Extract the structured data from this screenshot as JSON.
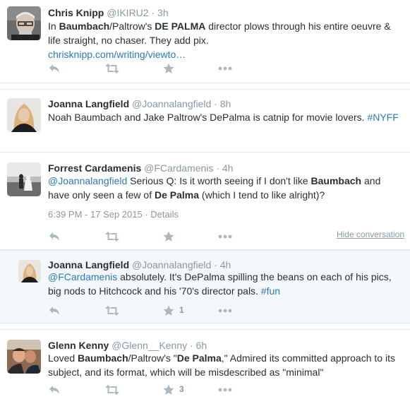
{
  "tweets": [
    {
      "fullname": "Chris Knipp",
      "username": "@IKIRU2",
      "dot": "·",
      "time": "3h",
      "text_parts": {
        "p1": "In ",
        "b1": "Baumbach",
        "p2": "/Paltrow's ",
        "b2": "DE PALMA",
        "p3": " director plows through his entire oeuvre &",
        "line2": "life straight, no chaser. They add pix.",
        "link": "chrisknipp.com/writing/viewto…"
      }
    },
    {
      "fullname": "Joanna Langfield",
      "username": "@Joannalangfield",
      "dot": "·",
      "time": "8h",
      "text_parts": {
        "p1": "Noah Baumbach and Jake Paltrow's DePalma is catnip for movie lovers. ",
        "hashtag": "#NYFF"
      }
    },
    {
      "fullname": "Forrest Cardamenis",
      "username": "@FCardamenis",
      "dot": "·",
      "time": "4h",
      "text_parts": {
        "mention": "@Joannalangfield",
        "p1": " Serious Q: Is it worth seeing if I don't like ",
        "b1": "Baumbach",
        "p2": " and",
        "line2a": "have only seen a few of ",
        "b2": "De Palma",
        "line2b": " (which I tend to like alright)?"
      },
      "timestamp": "6:39 PM - 17 Sep 2015",
      "meta_sep": "·",
      "details": "Details",
      "hide_conversation": "Hide conversation"
    },
    {
      "fullname": "Joanna Langfield",
      "username": "@Joannalangfield",
      "dot": "·",
      "time": "4h",
      "text_parts": {
        "mention": "@FCardamenis",
        "p1": " absolutely. It's DePalma spilling the beans on each of his pics,",
        "line2": "big nods to Hitchcock and his '70's director pals. ",
        "hashtag": "#fun"
      },
      "fav_count": "1"
    },
    {
      "fullname": "Glenn Kenny",
      "username": "@Glenn__Kenny",
      "dot": "·",
      "time": "6h",
      "text_parts": {
        "p1": "Loved ",
        "b1": "Baumbach",
        "p2": "/Paltrow's \"",
        "b2": "De Palma",
        "p3": ",\" Admired its committed approach to its",
        "line2": "subject, and its format, which will be misdescribed as \"minimal\""
      },
      "fav_count": "3"
    }
  ],
  "colors": {
    "icon": "#aab8c2",
    "link": "#2b7bb9",
    "muted": "#8899a6",
    "conversation_bg": "#f5f8fa"
  },
  "icons": [
    "reply-icon",
    "retweet-icon",
    "favorite-icon",
    "more-icon"
  ]
}
